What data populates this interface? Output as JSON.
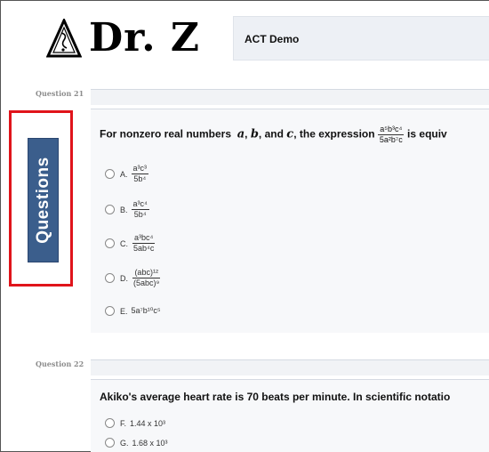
{
  "header": {
    "logo_text": "Dr. Z",
    "title": "ACT Demo"
  },
  "sidebar": {
    "label": "Questions"
  },
  "colors": {
    "highlight": "#e0141b",
    "tab": "#3b5e8c",
    "panel": "#f7f8fa"
  },
  "questions": [
    {
      "label": "Question 21",
      "text_prefix": "For nonzero real numbers",
      "var_a": "a",
      "var_b": "b",
      "text_and": ", and",
      "var_c": "c",
      "text_mid": ", the expression",
      "expr_num": "a⁵b³c⁴",
      "expr_den": "5a²b⁷c",
      "text_suffix": "is equiv",
      "options": [
        {
          "letter": "A.",
          "num": "a³c³",
          "den": "5b⁴"
        },
        {
          "letter": "B.",
          "num": "a³c⁴",
          "den": "5b⁴"
        },
        {
          "letter": "C.",
          "num": "a³bc⁴",
          "den": "5ab⁴c"
        },
        {
          "letter": "D.",
          "num": "(abc)¹²",
          "den": "(5abc)⁹"
        },
        {
          "letter": "E.",
          "text": "5a⁷b¹⁰c⁵"
        }
      ]
    },
    {
      "label": "Question 22",
      "text": "Akiko's average heart rate is 70 beats per minute. In scientific notatio",
      "options": [
        {
          "letter": "F.",
          "text": "1.44 x 10³"
        },
        {
          "letter": "G.",
          "text": "1.68 x 10³"
        }
      ]
    }
  ]
}
